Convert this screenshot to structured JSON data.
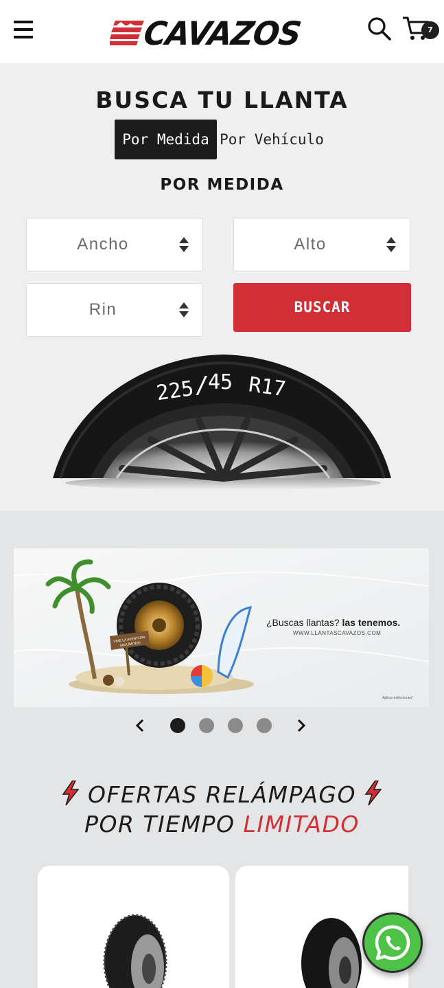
{
  "header": {
    "menu_icon": "hamburger-icon",
    "logo_text": "CAVAZOS",
    "search_icon": "search-icon",
    "cart_icon": "cart-icon",
    "cart_count": "7"
  },
  "finder": {
    "title": "BUSCA TU LLANTA",
    "tabs": [
      {
        "label": "Por Medida",
        "active": true
      },
      {
        "label": "Por Vehículo",
        "active": false
      }
    ],
    "subtitle": "POR MEDIDA",
    "selects": {
      "ancho": "Ancho",
      "alto": "Alto",
      "rin": "Rin"
    },
    "search_button": "BUSCAR",
    "tire_size_width": "225",
    "tire_size_ratio": "45",
    "tire_size_rim": "R17"
  },
  "banner": {
    "headline_regular": "¿Buscas llantas? ",
    "headline_bold": "las tenemos.",
    "url": "WWW.LLANTASCAVAZOS.COM",
    "note": "Aplica restricciones*",
    "sign_line1": "VIVE LA AVENTURA",
    "sign_line2": "SIN LÍMITES!"
  },
  "carousel": {
    "slides": 4,
    "active_index": 0
  },
  "offers": {
    "line1": "OFERTAS RELÁMPAGO",
    "line2_black": "POR TIEMPO ",
    "line2_red": "LIMITADO"
  },
  "colors": {
    "brand_red": "#d12f35",
    "dark": "#1c1c1c",
    "whatsapp_green": "#4dc247"
  }
}
